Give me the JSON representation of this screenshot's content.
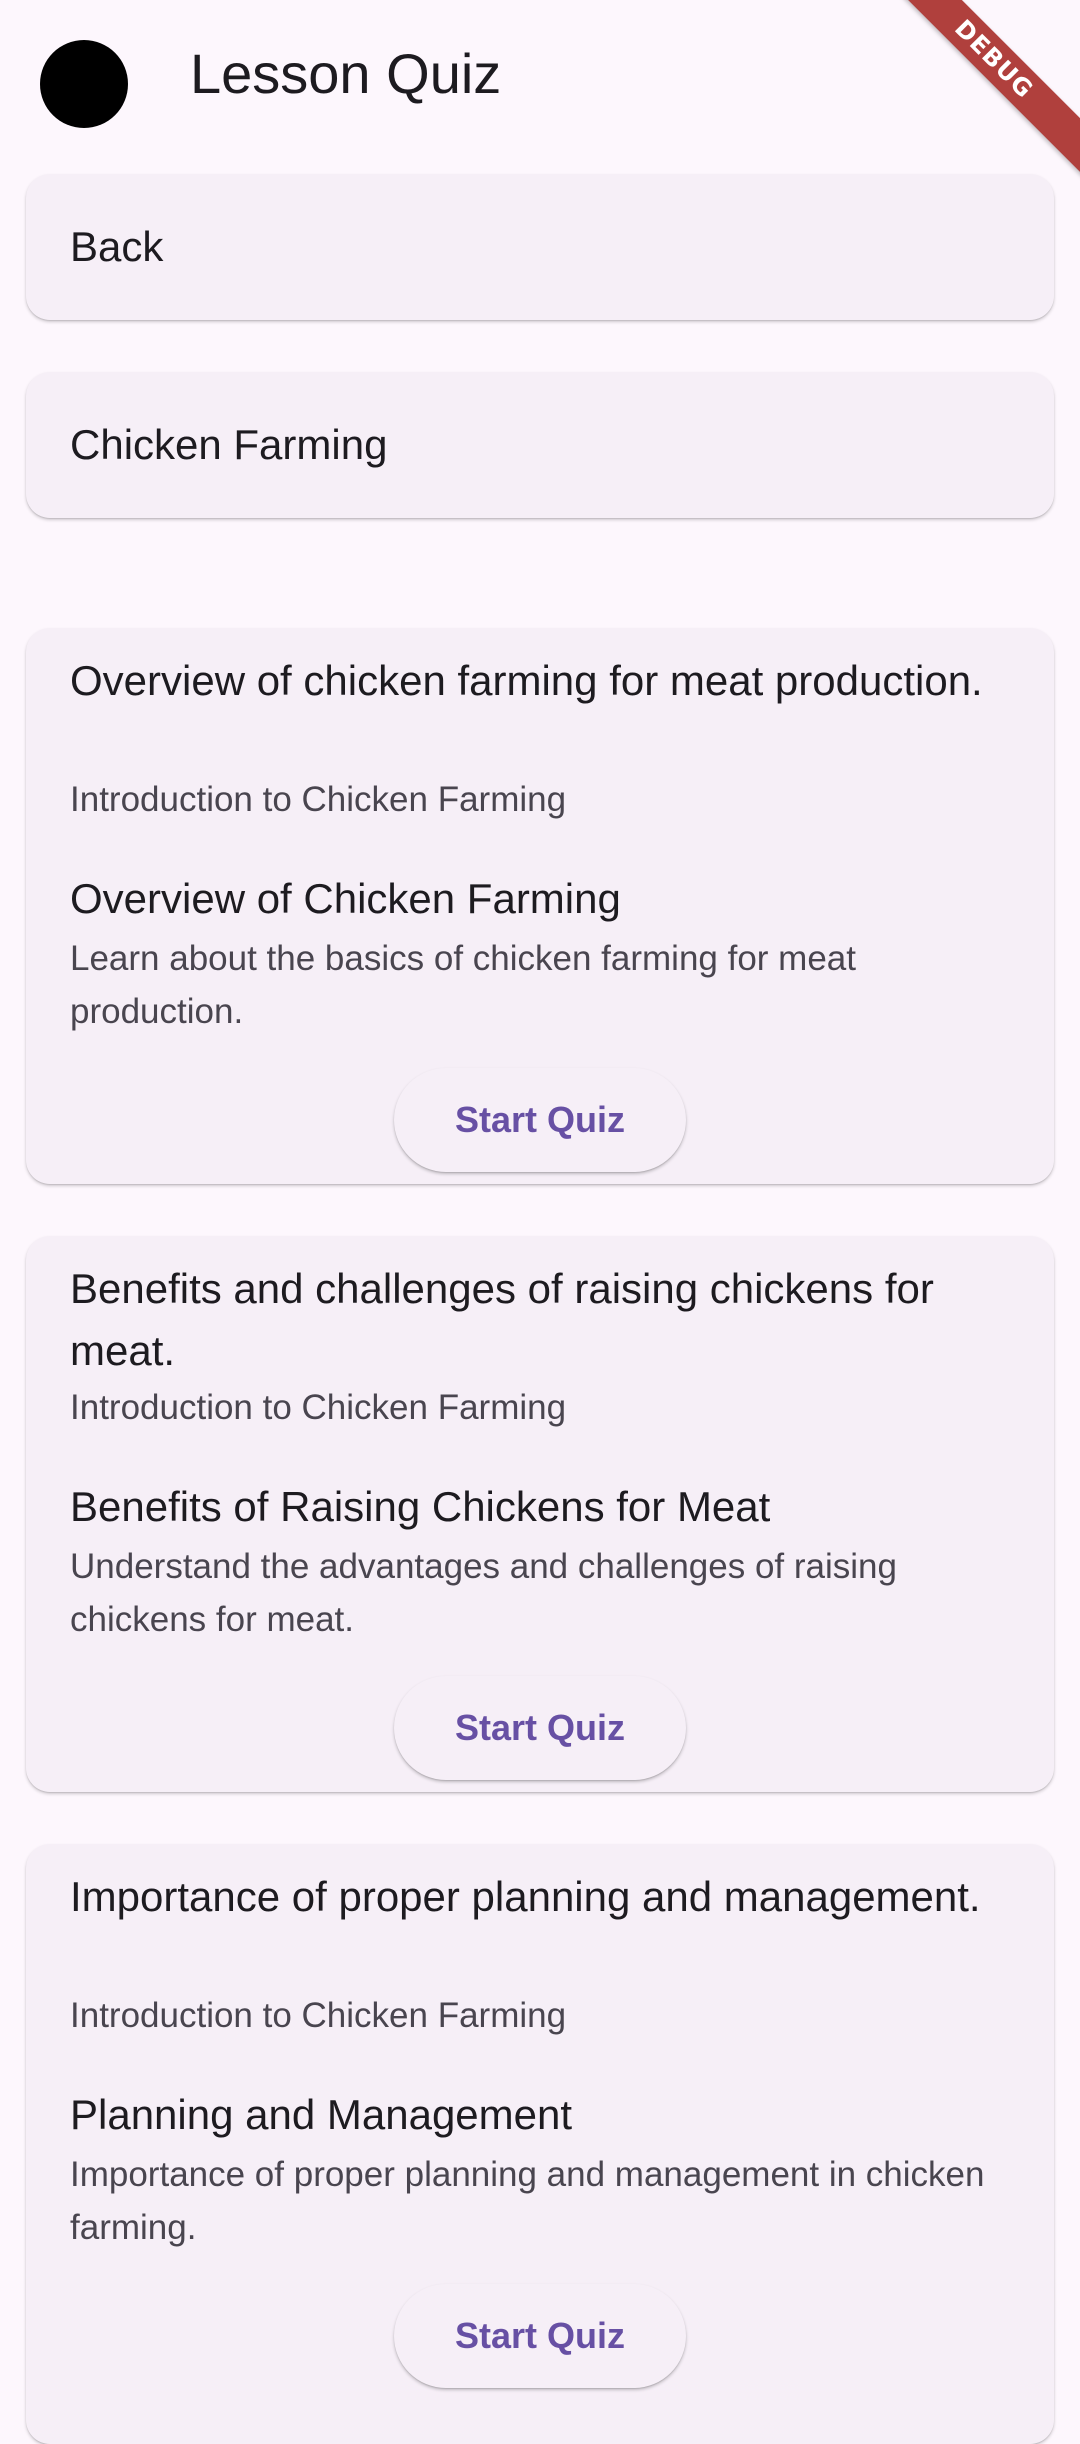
{
  "app": {
    "title": "Lesson Quiz",
    "debug_banner": "DEBUG"
  },
  "nav": {
    "back_label": "Back",
    "topic_label": "Chicken Farming"
  },
  "lessons": [
    {
      "heading": "Overview of chicken farming for meat production.",
      "subheading": "Introduction to Chicken Farming",
      "title": "Overview of Chicken Farming",
      "description": "Learn about the basics of chicken farming for meat production.",
      "button_label": "Start Quiz"
    },
    {
      "heading": "Benefits and challenges of raising chickens for meat.",
      "subheading": "Introduction to Chicken Farming",
      "title": "Benefits of Raising Chickens for Meat",
      "description": "Understand the advantages and challenges of raising chickens for meat.",
      "button_label": "Start Quiz"
    },
    {
      "heading": "Importance of proper planning and management.",
      "subheading": "Introduction to Chicken Farming",
      "title": "Planning and Management",
      "description": "Importance of proper planning and management in chicken farming.",
      "button_label": "Start Quiz"
    }
  ],
  "colors": {
    "background": "#fdf7fd",
    "card": "#f6eff7",
    "primary": "#6750a4",
    "on_surface": "#1d1b20",
    "on_surface_variant": "#49454f",
    "debug_banner": "#b0403d",
    "avatar": "#000000"
  }
}
